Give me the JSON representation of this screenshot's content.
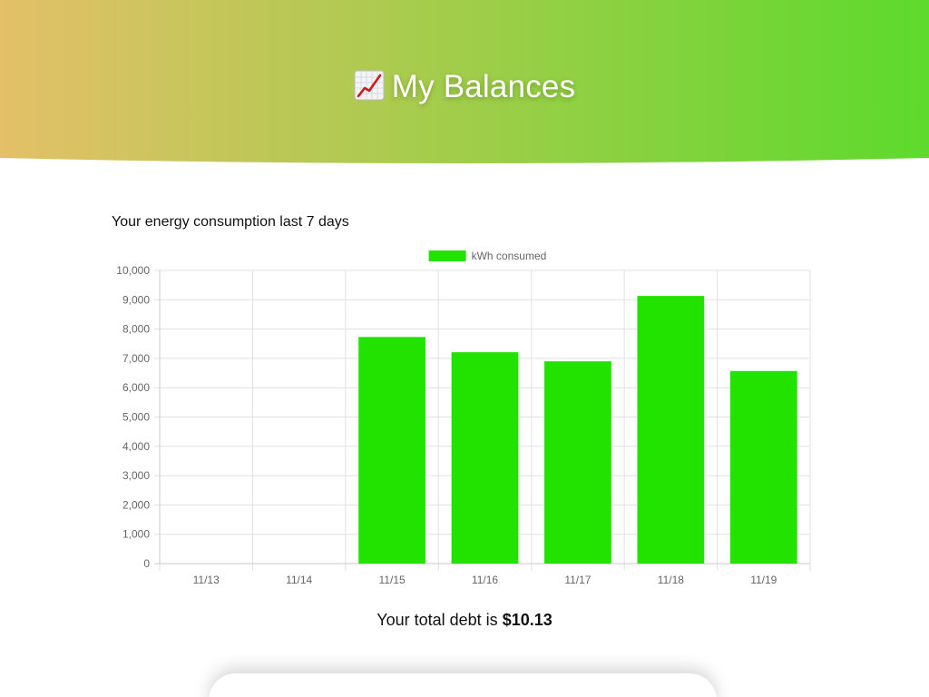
{
  "header": {
    "title": "My Balances",
    "icon": "chart-increasing-icon",
    "gradient_start": "#e4c068",
    "gradient_end": "#5dda2c"
  },
  "chart_title": "Your energy consumption last 7 days",
  "chart_data": {
    "type": "bar",
    "categories": [
      "11/13",
      "11/14",
      "11/15",
      "11/16",
      "11/17",
      "11/18",
      "11/19"
    ],
    "series": [
      {
        "name": "kWh consumed",
        "values": [
          0,
          0,
          7730,
          7210,
          6900,
          9130,
          6570
        ],
        "color": "#22e300"
      }
    ],
    "ylim": [
      0,
      10000
    ],
    "yticks": [
      "0",
      "1,000",
      "2,000",
      "3,000",
      "4,000",
      "5,000",
      "6,000",
      "7,000",
      "8,000",
      "9,000",
      "10,000"
    ],
    "grid": true,
    "legend": "top-center"
  },
  "debt": {
    "prefix": "Your total debt is",
    "amount": "$10.13"
  }
}
